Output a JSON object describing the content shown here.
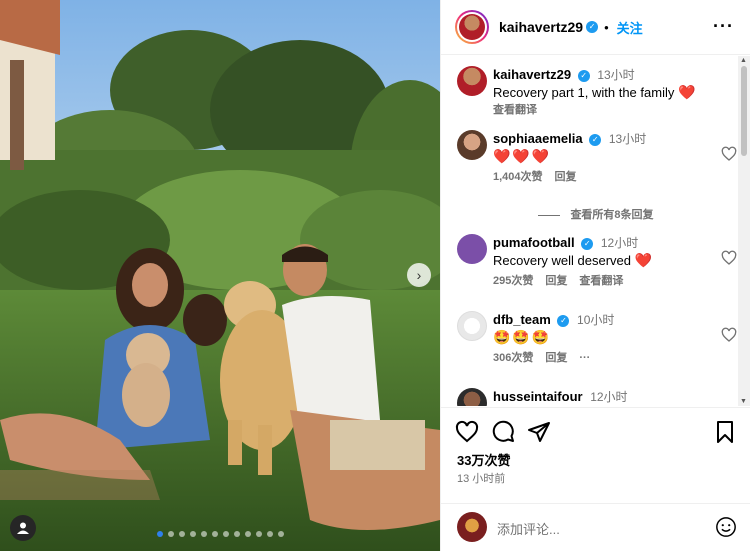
{
  "post": {
    "author": "kaihavertz29",
    "follow_label": "关注",
    "caption_time": "13小时",
    "caption": "Recovery part 1, with the family",
    "caption_emoji": "❤️",
    "translate": "查看翻译",
    "likes": "33万次赞",
    "posted_ago": "13 小时前",
    "carousel": {
      "slides": 12,
      "current": 1
    }
  },
  "comments": [
    {
      "user": "sophiaaemelia",
      "time": "13小时",
      "text": "❤️❤️❤️",
      "likes": "1,404次赞",
      "reply": "回复"
    },
    {
      "user": "pumafootball",
      "time": "12小时",
      "text": "Recovery well deserved",
      "emoji": "❤️",
      "likes": "295次赞",
      "reply": "回复",
      "translate": "查看翻译"
    },
    {
      "user": "dfb_team",
      "time": "10小时",
      "text": "🤩🤩🤩",
      "likes": "306次赞",
      "reply": "回复"
    },
    {
      "user": "husseintaifour",
      "time": "12小时"
    }
  ],
  "view_replies": "查看所有8条回复",
  "composer": {
    "placeholder": "添加评论..."
  },
  "icons": [
    "heart-icon",
    "comment-icon",
    "share-icon",
    "bookmark-icon",
    "more-icon",
    "emoji-icon",
    "verified-icon",
    "chevron-right-icon",
    "user-tag-icon"
  ],
  "colors": {
    "accent": "#0095f6",
    "verified": "#1d9bf0",
    "heart": "#e0245e",
    "muted": "#737373"
  }
}
